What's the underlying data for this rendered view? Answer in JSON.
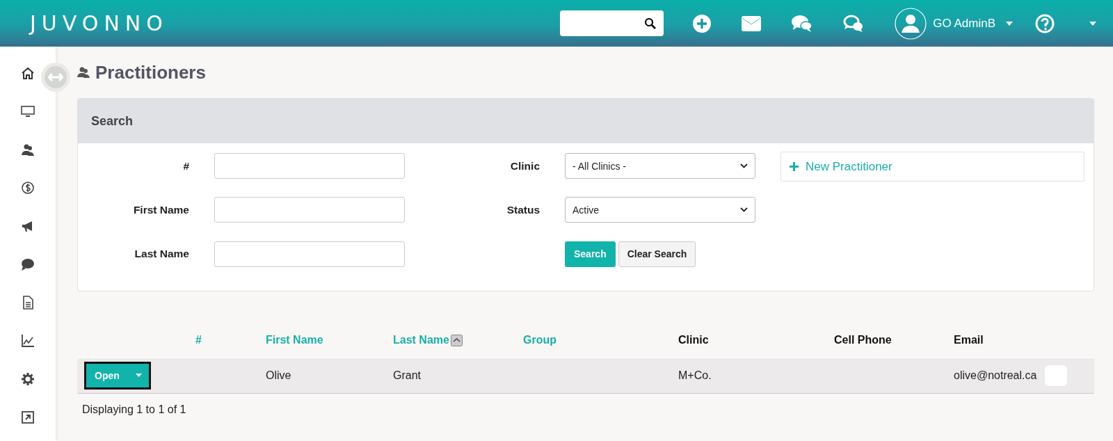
{
  "header": {
    "logo": "JUVONNO",
    "user": "GO AdminB"
  },
  "page_title": "Practitioners",
  "search_panel": {
    "title": "Search",
    "fields": [
      {
        "label": "#",
        "kind": "text"
      },
      {
        "label": "Clinic",
        "kind": "select",
        "value": "- All Clinics -"
      },
      {
        "label": "First Name",
        "kind": "text"
      },
      {
        "label": "Status",
        "kind": "select",
        "value": "Active"
      },
      {
        "label": "Last Name",
        "kind": "text"
      }
    ],
    "search_button": "Search",
    "clear_button": "Clear Search",
    "new_button": "New Practitioner"
  },
  "table": {
    "columns": [
      {
        "label": "#",
        "sortable": true,
        "sorted": false
      },
      {
        "label": "First Name",
        "sortable": true,
        "sorted": false
      },
      {
        "label": "Last Name",
        "sortable": true,
        "sorted": true
      },
      {
        "label": "Group",
        "sortable": true,
        "sorted": false
      },
      {
        "label": "Clinic",
        "sortable": false,
        "sorted": false
      },
      {
        "label": "Cell Phone",
        "sortable": false,
        "sorted": false
      },
      {
        "label": "Email",
        "sortable": false,
        "sorted": false
      }
    ],
    "rows": [
      {
        "action": "Open",
        "cells": [
          "",
          "Olive",
          "Grant",
          "",
          "M+Co.",
          "",
          "olive@notreal.ca"
        ]
      }
    ]
  },
  "footer_text": "Displaying 1 to 1 of 1"
}
